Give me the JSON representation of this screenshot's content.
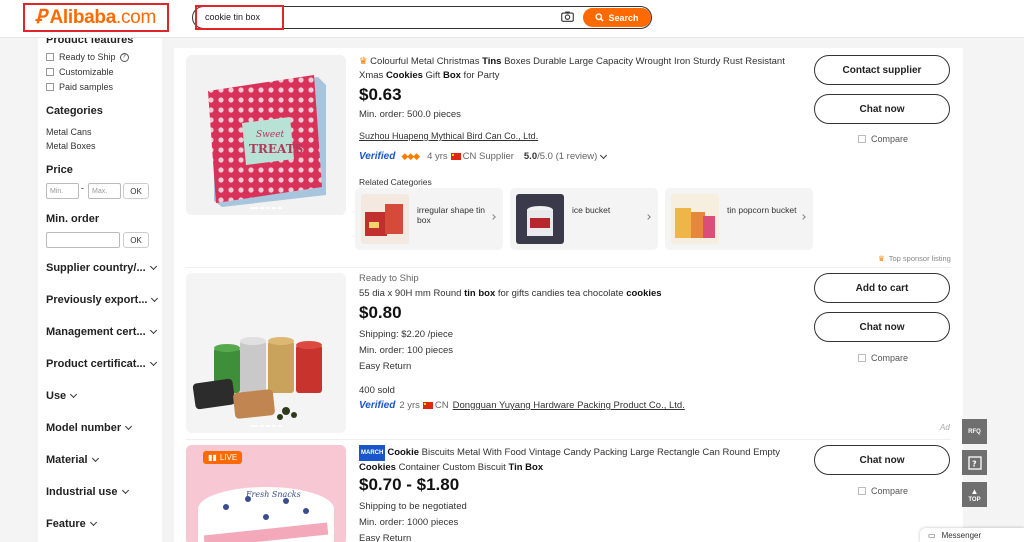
{
  "header": {
    "logo_text": "Alibaba",
    "logo_suffix": ".com",
    "search_value": "cookie tin box",
    "search_button": "Search"
  },
  "sidebar": {
    "product_features_title": "Product features",
    "features": [
      "Ready to Ship",
      "Customizable",
      "Paid samples"
    ],
    "categories_title": "Categories",
    "categories": [
      "Metal Cans",
      "Metal Boxes"
    ],
    "price_title": "Price",
    "price_min_placeholder": "Min.",
    "price_separator": "-",
    "price_max_placeholder": "Max.",
    "ok_label": "OK",
    "min_order_title": "Min. order",
    "dropdowns": [
      "Supplier country/...",
      "Previously export...",
      "Management cert...",
      "Product certificat...",
      "Use",
      "Model number",
      "Material",
      "Industrial use",
      "Feature"
    ]
  },
  "products": [
    {
      "title_html_parts": [
        "Colourful Metal Christmas ",
        "Tins",
        " Boxes Durable Large Capacity Wrought Iron Sturdy Rust Resistant Xmas ",
        "Cookies",
        " Gift ",
        "Box",
        " for Party"
      ],
      "price": "$0.63",
      "min_order": "Min. order: 500.0 pieces",
      "supplier": "Suzhou Huapeng Mythical Bird Can Co., Ltd.",
      "verified": "Verified",
      "years": "4 yrs",
      "country": "CN Supplier",
      "rating": "5.0",
      "rating_suffix": "/5.0 (1 review)",
      "related_title": "Related Categories",
      "related": [
        "irregular shape tin box",
        "ice bucket",
        "tin popcorn bucket"
      ],
      "cta1": "Contact supplier",
      "cta2": "Chat now",
      "compare": "Compare",
      "sponsor": "Top sponsor listing",
      "image_text_line1": "Sweet",
      "image_text_line2": "TREATS"
    },
    {
      "tag": "Ready to Ship",
      "title_parts": [
        "55 dia x 90H mm Round ",
        "tin box",
        " for gifts candies tea chocolate ",
        "cookies"
      ],
      "price": "$0.80",
      "shipping": "Shipping: $2.20 /piece",
      "min_order": "Min. order: 100 pieces",
      "easy_return": "Easy Return",
      "sold": "400 sold",
      "verified": "Verified",
      "years": "2 yrs",
      "country": "CN",
      "supplier": "Dongguan Yuyang Hardware Packing Product Co., Ltd.",
      "cta1": "Add to cart",
      "cta2": "Chat now",
      "compare": "Compare",
      "ad": "Ad"
    },
    {
      "live": "LIVE",
      "march": "MARCH",
      "title_parts": [
        "Cookie",
        " Biscuits Metal With Food Vintage Candy Packing Large Rectangle Can Round Empty ",
        "Cookies",
        " Container Custom Biscuit ",
        "Tin Box"
      ],
      "price": "$0.70 - $1.80",
      "shipping": "Shipping to be negotiated",
      "min_order": "Min. order: 1000 pieces",
      "easy_return": "Easy Return",
      "cta2": "Chat now",
      "compare": "Compare",
      "image_text": "Fresh Snacks"
    }
  ],
  "widgets": {
    "rfq": "RFQ",
    "top": "TOP",
    "messenger": "Messenger"
  },
  "colors": {
    "brand": "#ff6a00",
    "highlight_border": "#e0262b",
    "verified_blue": "#1a55c9"
  }
}
